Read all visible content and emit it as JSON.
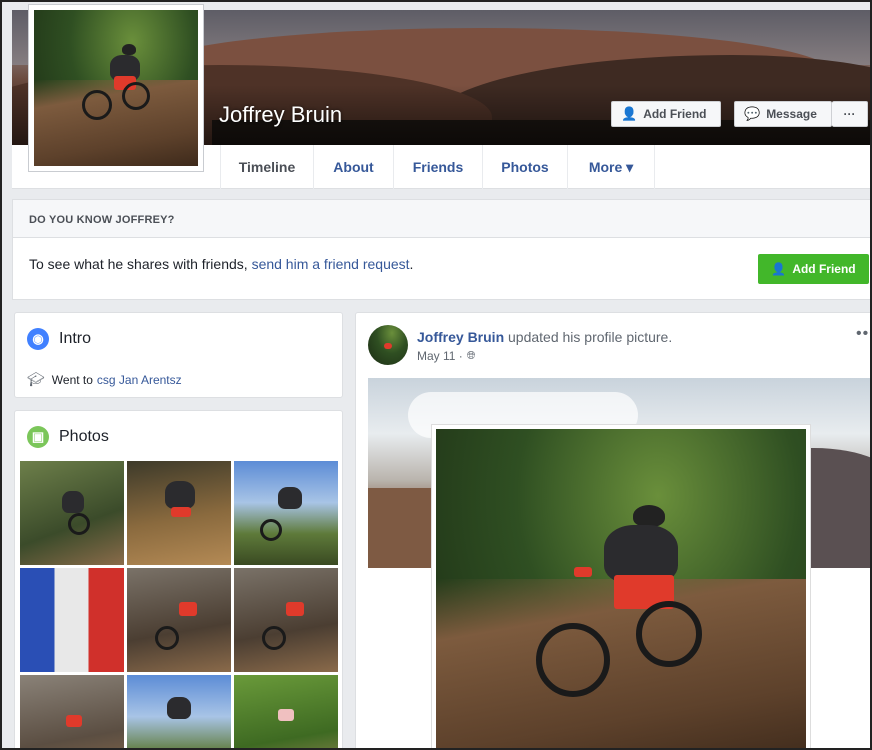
{
  "profile": {
    "name": "Joffrey Bruin"
  },
  "cover_actions": {
    "add_friend_label": "Add Friend",
    "message_label": "Message",
    "more_dots": "···"
  },
  "nav": {
    "tabs": [
      {
        "label": "Timeline",
        "active": true
      },
      {
        "label": "About"
      },
      {
        "label": "Friends"
      },
      {
        "label": "Photos"
      },
      {
        "label": "More ▾"
      }
    ]
  },
  "know_box": {
    "heading": "DO YOU KNOW JOFFREY?",
    "text_prefix": "To see what he shares with friends, ",
    "link": "send him a friend request",
    "text_suffix": ".",
    "button_label": "Add Friend"
  },
  "intro": {
    "title": "Intro",
    "went_to_prefix": "Went to",
    "school": "csg Jan Arentsz"
  },
  "photos": {
    "title": "Photos"
  },
  "post": {
    "author": "Joffrey Bruin",
    "action": " updated his profile picture.",
    "date": "May 11 ·",
    "menu": "•••"
  },
  "icons": {
    "intro": "globe-icon",
    "photos": "photo-icon",
    "education": "graduation-cap-icon",
    "add_friend": "add-friend-icon",
    "message": "messenger-icon",
    "privacy": "globe-icon"
  },
  "colors": {
    "link_blue": "#365899",
    "green_button": "#42b72a",
    "intro_icon": "#4080ff",
    "photos_icon": "#7bc65a"
  }
}
